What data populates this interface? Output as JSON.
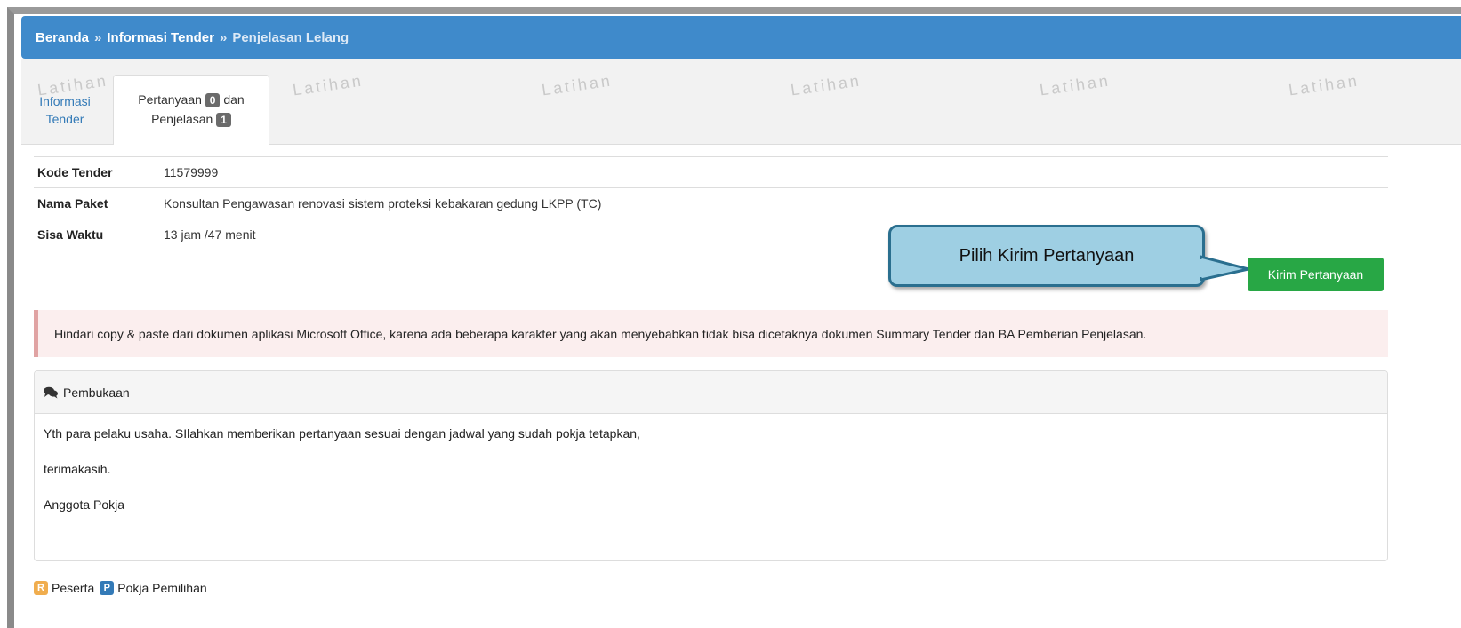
{
  "breadcrumb": {
    "home": "Beranda",
    "separator": "»",
    "section": "Informasi Tender",
    "current": "Penjelasan Lelang"
  },
  "tabs": {
    "info_tab": {
      "line1": "Informasi",
      "line2": "Tender"
    },
    "qa_tab": {
      "prefix": "Pertanyaan",
      "questions_count": "0",
      "joiner": "dan",
      "suffix": "Penjelasan",
      "answers_count": "1"
    }
  },
  "watermark": "Latihan",
  "tender_info": {
    "rows": [
      {
        "label": "Kode Tender",
        "value": "11579999"
      },
      {
        "label": "Nama Paket",
        "value": "Konsultan Pengawasan renovasi sistem proteksi kebakaran gedung LKPP (TC)"
      },
      {
        "label": "Sisa Waktu",
        "value": "13 jam /47 menit"
      }
    ]
  },
  "callout": {
    "text": "Pilih Kirim Pertanyaan"
  },
  "actions": {
    "send_question_label": "Kirim Pertanyaan"
  },
  "alert": {
    "text": "Hindari copy & paste dari dokumen aplikasi Microsoft Office, karena ada beberapa karakter yang akan menyebabkan tidak bisa dicetaknya dokumen Summary Tender dan BA Pemberian Penjelasan."
  },
  "panel": {
    "title": "Pembukaan",
    "paragraphs": [
      "Yth para pelaku usaha. SIlahkan memberikan pertanyaan sesuai dengan jadwal yang sudah pokja tetapkan,",
      "terimakasih.",
      "Anggota Pokja"
    ]
  },
  "legend": [
    {
      "badge": "R",
      "label": "Peserta",
      "color": "#f0ad4e"
    },
    {
      "badge": "P",
      "label": "Pokja Pemilihan",
      "color": "#337ab7"
    }
  ],
  "colors": {
    "header": "#3f8acb",
    "primary_button": "#28a745",
    "callout_fill": "#9ecfe3",
    "alert_bg": "#fbeeee"
  }
}
